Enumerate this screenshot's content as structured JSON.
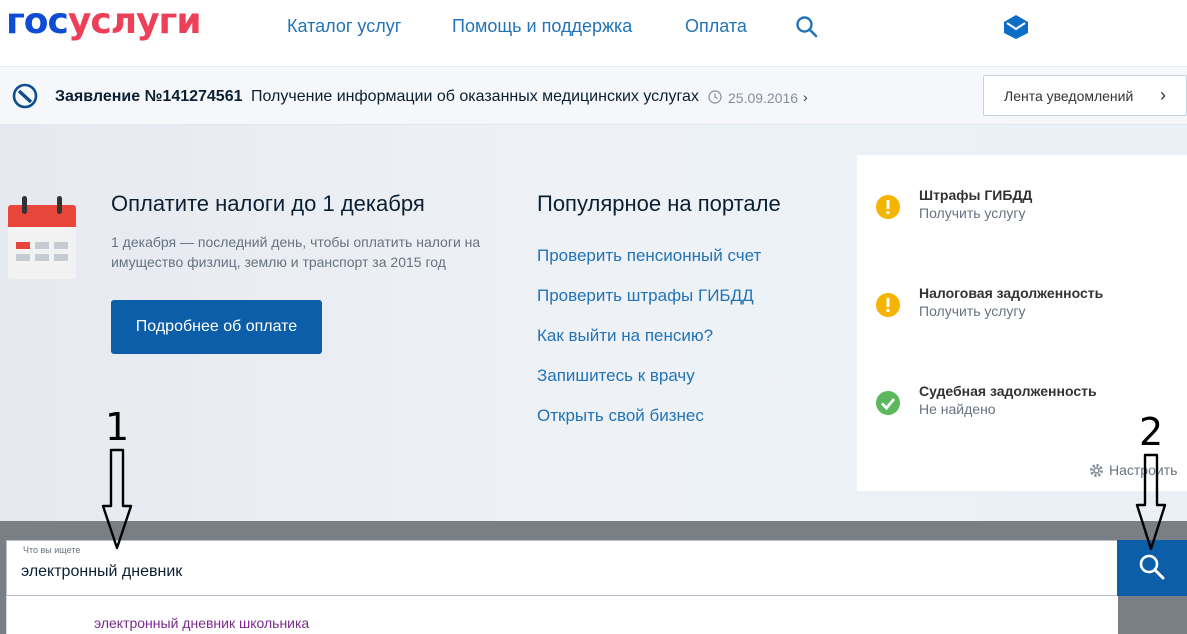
{
  "header": {
    "logo_part1": "гос",
    "logo_part2": "услуги",
    "nav": [
      "Каталог услуг",
      "Помощь и поддержка",
      "Оплата"
    ],
    "search_icon": "search-icon",
    "badge_icon": "envelope-icon"
  },
  "notification": {
    "number": "Заявление №141274561",
    "text": "Получение информации об оказанных медицинских услугах",
    "date": "25.09.2016",
    "feed_button": "Лента уведомлений"
  },
  "promo": {
    "title": "Оплатите налоги до 1 декабря",
    "description": "1 декабря — последний день, чтобы оплатить налоги на имущество физлиц, землю и транспорт за 2015 год",
    "button": "Подробнее об оплате"
  },
  "popular": {
    "title": "Популярное на портале",
    "links": [
      "Проверить пенсионный счет",
      "Проверить штрафы ГИБДД",
      "Как выйти на пенсию?",
      "Запишитесь к врачу",
      "Открыть свой бизнес"
    ]
  },
  "sidebar": {
    "items": [
      {
        "title": "Штрафы ГИБДД",
        "subtitle": "Получить услугу",
        "status": "warning"
      },
      {
        "title": "Налоговая задолженность",
        "subtitle": "Получить услугу",
        "status": "warning"
      },
      {
        "title": "Судебная задолженность",
        "subtitle": "Не найдено",
        "status": "ok"
      }
    ],
    "settings": "Настроить"
  },
  "search": {
    "caption": "Что вы ищете",
    "value": "электронный дневник",
    "suggestion": "электронный дневник школьника"
  },
  "annotations": {
    "label1": "1",
    "label2": "2"
  },
  "colors": {
    "brand_blue": "#0d4cd3",
    "brand_red": "#ee3f58",
    "link_blue": "#2273b7",
    "button_blue": "#0d5ea8",
    "warning": "#f5b400",
    "ok": "#5cb85c"
  }
}
